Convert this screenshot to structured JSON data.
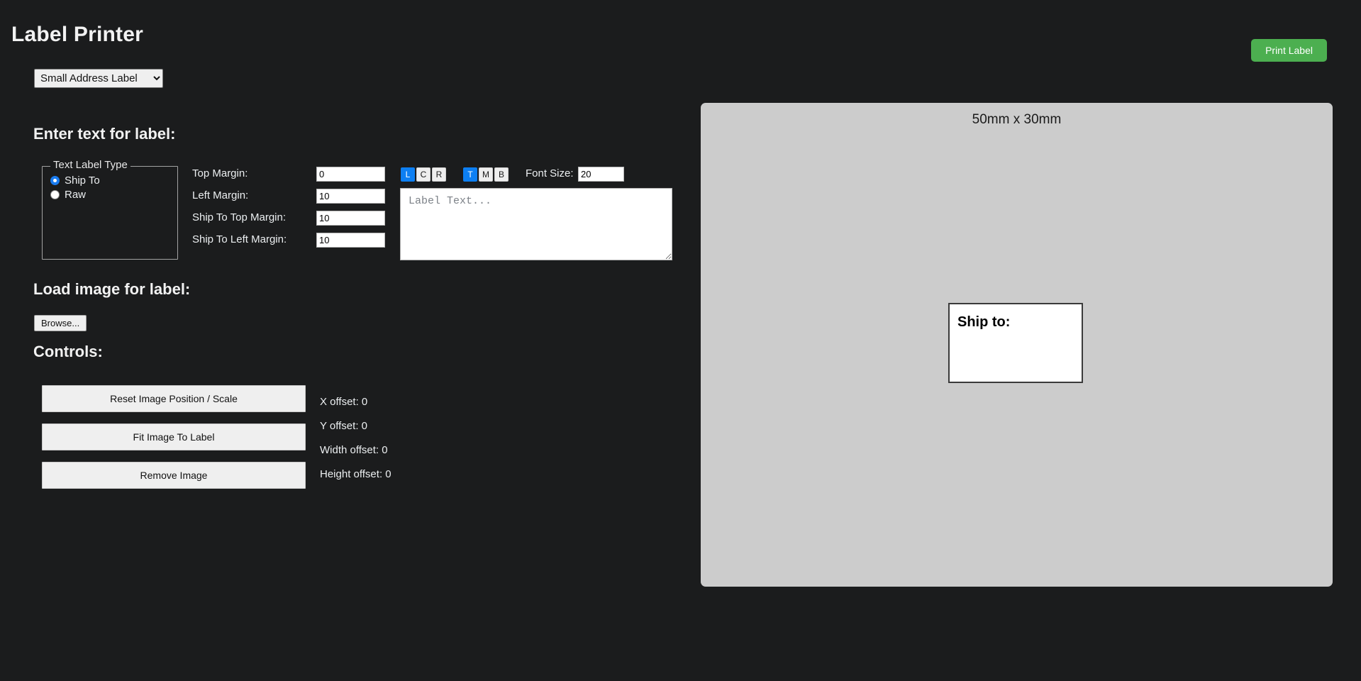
{
  "header": {
    "title": "Label Printer",
    "print_button": "Print Label"
  },
  "label_size_select": {
    "selected": "Small Address Label",
    "options": [
      "Small Address Label"
    ]
  },
  "sections": {
    "text_heading": "Enter text for label:",
    "image_heading": "Load image for label:",
    "controls_heading": "Controls:"
  },
  "text_label_type": {
    "legend": "Text Label Type",
    "options": [
      {
        "label": "Ship To",
        "selected": true
      },
      {
        "label": "Raw",
        "selected": false
      }
    ]
  },
  "margins": [
    {
      "label": "Top Margin:",
      "value": "0"
    },
    {
      "label": "Left Margin:",
      "value": "10"
    },
    {
      "label": "Ship To Top Margin:",
      "value": "10"
    },
    {
      "label": "Ship To Left Margin:",
      "value": "10"
    }
  ],
  "horizontal_align": [
    {
      "label": "L",
      "active": true
    },
    {
      "label": "C",
      "active": false
    },
    {
      "label": "R",
      "active": false
    }
  ],
  "vertical_align": [
    {
      "label": "T",
      "active": true
    },
    {
      "label": "M",
      "active": false
    },
    {
      "label": "B",
      "active": false
    }
  ],
  "font_size": {
    "label": "Font Size:",
    "value": "20"
  },
  "label_text": {
    "placeholder": "Label Text...",
    "value": ""
  },
  "image_loader": {
    "browse_button": "Browse..."
  },
  "controls": {
    "buttons": [
      "Reset Image Position / Scale",
      "Fit Image To Label",
      "Remove Image"
    ],
    "offsets": [
      "X offset: 0",
      "Y offset: 0",
      "Width offset: 0",
      "Height offset: 0"
    ]
  },
  "preview": {
    "size_text": "50mm x 30mm",
    "label_content": "Ship to:"
  },
  "colors": {
    "background": "#1b1c1d",
    "accent_blue": "#0d7ff2",
    "print_green": "#4caf50",
    "panel_gray": "#cccccc"
  }
}
